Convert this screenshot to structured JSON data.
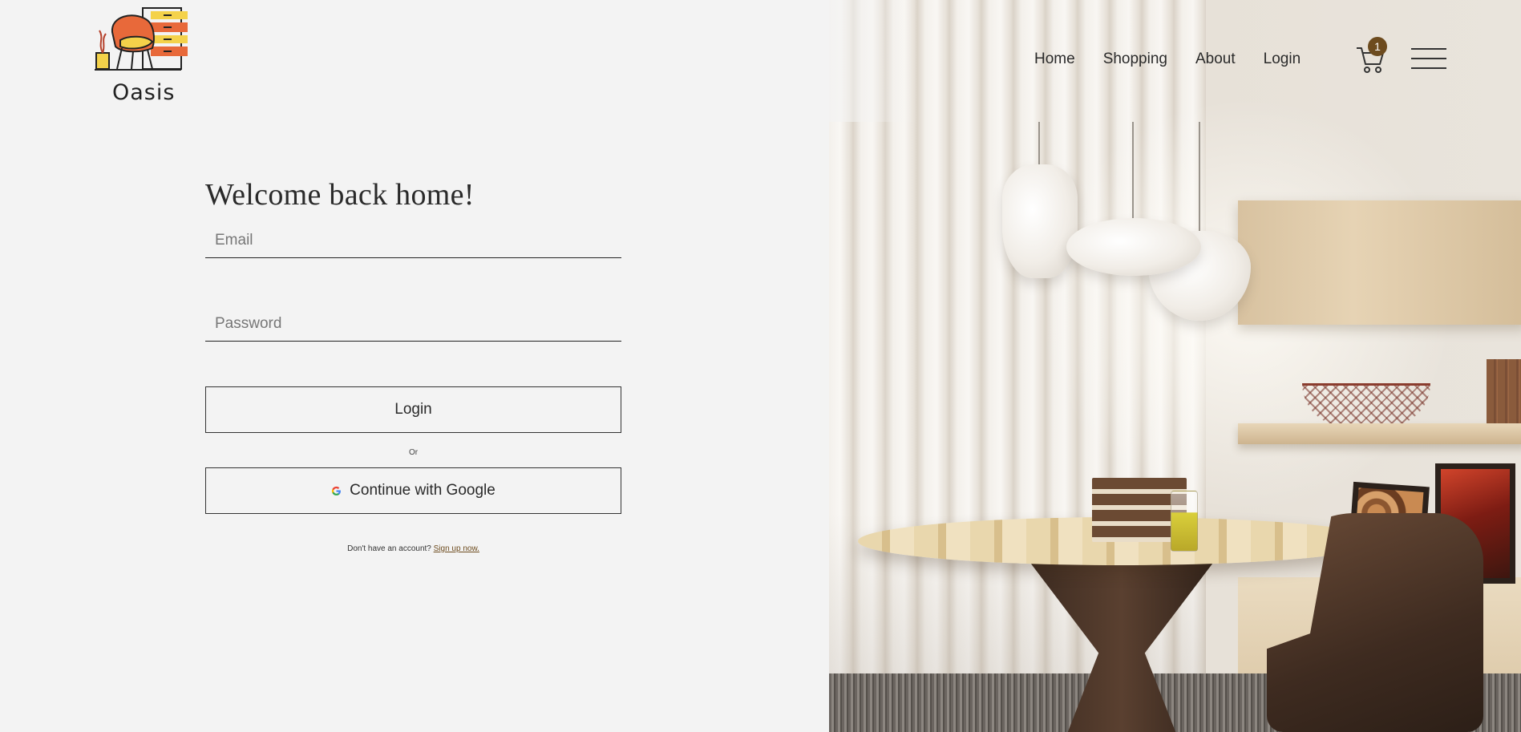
{
  "brand": {
    "name": "Oasis",
    "logo_icon": "armchair-drawers-logo-icon"
  },
  "nav": {
    "items": [
      {
        "label": "Home"
      },
      {
        "label": "Shopping"
      },
      {
        "label": "About"
      },
      {
        "label": "Login"
      }
    ],
    "cart_icon": "cart-icon",
    "cart_count": "1",
    "menu_icon": "hamburger-menu-icon"
  },
  "login": {
    "heading": "Welcome back home!",
    "email_placeholder": "Email",
    "email_value": "",
    "password_placeholder": "Password",
    "password_value": "",
    "login_label": "Login",
    "or_label": "Or",
    "google_label": "Continue with Google",
    "google_icon": "google-g-icon",
    "signup_prompt": "Don't have an account?",
    "signup_link": "Sign up now."
  },
  "colors": {
    "background": "#f3f3f3",
    "accent": "#6d4b1e",
    "text": "#222222",
    "logo_orange": "#e8693a",
    "logo_yellow": "#f4d24a"
  },
  "hero": {
    "image": "dining-room-interior-photo"
  }
}
